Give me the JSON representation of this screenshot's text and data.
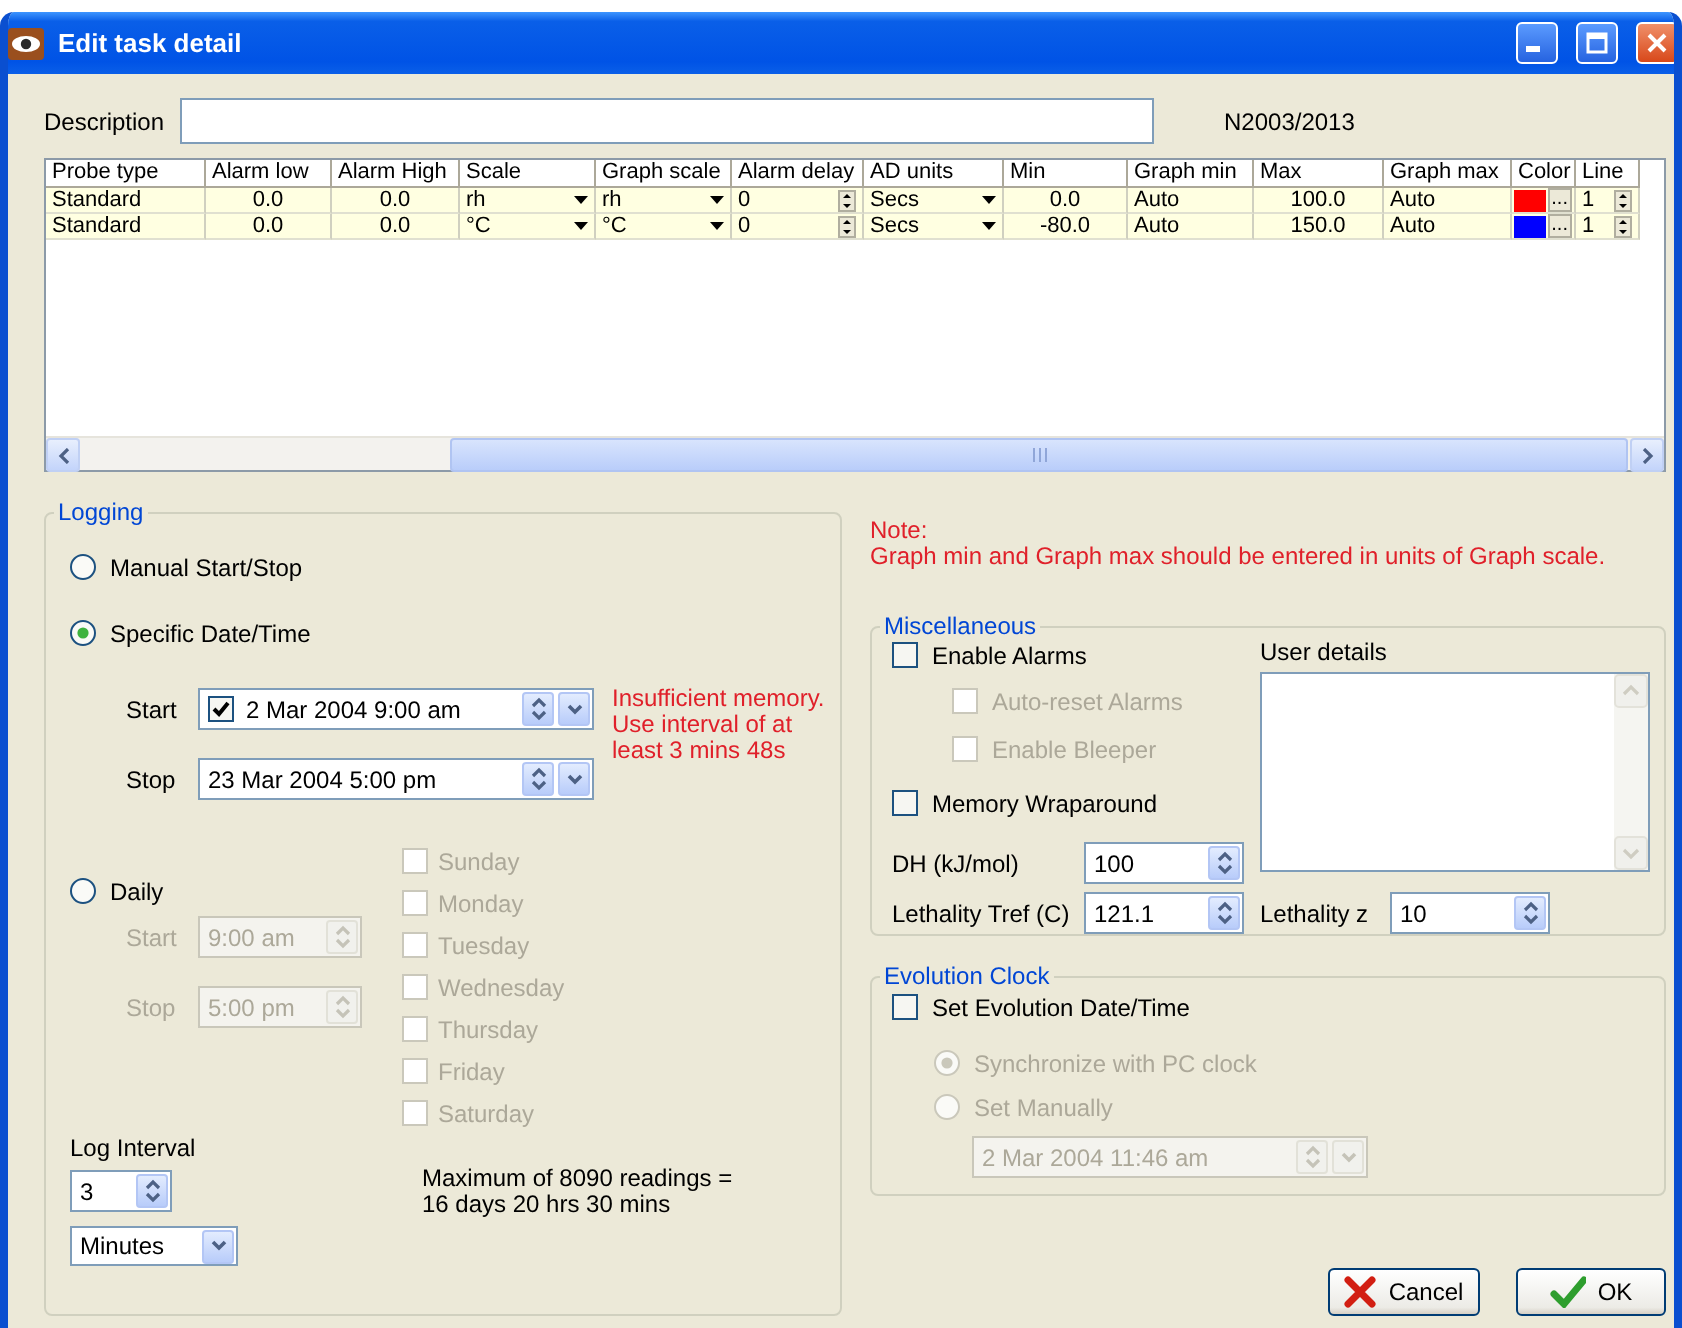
{
  "window": {
    "title": "Edit task detail"
  },
  "description": {
    "label": "Description"
  },
  "task_id": "N2003/2013",
  "probe_table": {
    "columns": [
      {
        "label": "Probe type",
        "kind": "text"
      },
      {
        "label": "Alarm low",
        "kind": "number"
      },
      {
        "label": "Alarm High",
        "kind": "number"
      },
      {
        "label": "Scale",
        "kind": "combo"
      },
      {
        "label": "Graph scale",
        "kind": "combo"
      },
      {
        "label": "Alarm delay",
        "kind": "spin"
      },
      {
        "label": "AD units",
        "kind": "combo"
      },
      {
        "label": "Min",
        "kind": "number"
      },
      {
        "label": "Graph min",
        "kind": "text"
      },
      {
        "label": "Max",
        "kind": "number"
      },
      {
        "label": "Graph max",
        "kind": "text"
      },
      {
        "label": "Color",
        "kind": "color"
      },
      {
        "label": "Line",
        "kind": "spin"
      }
    ],
    "rows": [
      {
        "cells": [
          "Standard",
          "0.0",
          "0.0",
          "rh",
          "rh",
          "0",
          "Secs",
          "0.0",
          "Auto",
          "100.0",
          "Auto",
          "1"
        ],
        "color": "#ff0000",
        "color_button": "..."
      },
      {
        "cells": [
          "Standard",
          "0.0",
          "0.0",
          "°C",
          "°C",
          "0",
          "Secs",
          "-80.0",
          "Auto",
          "150.0",
          "Auto",
          "1"
        ],
        "color": "#0000ff",
        "color_button": "..."
      }
    ]
  },
  "logging": {
    "title": "Logging",
    "modes": [
      {
        "label": "Manual Start/Stop",
        "selected": false
      },
      {
        "label": "Specific Date/Time",
        "selected": true
      },
      {
        "label": "Daily",
        "selected": false
      }
    ],
    "specific": {
      "start": {
        "label": "Start",
        "checked": true,
        "value": "2 Mar 2004 9:00 am"
      },
      "stop": {
        "label": "Stop",
        "value": "23 Mar 2004 5:00 pm"
      },
      "warning": "Insufficient memory.\nUse interval of at\nleast 3 mins 48s"
    },
    "daily": {
      "disabled": true,
      "start": {
        "label": "Start",
        "value": "9:00 am"
      },
      "stop": {
        "label": "Stop",
        "value": "5:00 pm"
      },
      "days": [
        {
          "label": "Sunday",
          "checked": false,
          "disabled": true
        },
        {
          "label": "Monday",
          "checked": false,
          "disabled": true
        },
        {
          "label": "Tuesday",
          "checked": false,
          "disabled": true
        },
        {
          "label": "Wednesday",
          "checked": false,
          "disabled": true
        },
        {
          "label": "Thursday",
          "checked": false,
          "disabled": true
        },
        {
          "label": "Friday",
          "checked": false,
          "disabled": true
        },
        {
          "label": "Saturday",
          "checked": false,
          "disabled": true
        }
      ]
    },
    "interval": {
      "label": "Log Interval",
      "value": "3",
      "unit": "Minutes"
    },
    "maximum": "Maximum of 8090 readings =\n16 days 20 hrs 30 mins"
  },
  "note": {
    "title": "Note:",
    "text": "Graph min and Graph max should be entered in units of Graph scale."
  },
  "misc": {
    "title": "Miscellaneous",
    "options": [
      {
        "label": "Enable Alarms",
        "checked": false,
        "disabled": false,
        "children": [
          {
            "label": "Auto-reset Alarms",
            "checked": false,
            "disabled": true
          },
          {
            "label": "Enable Bleeper",
            "checked": false,
            "disabled": true
          }
        ]
      },
      {
        "label": "Memory Wraparound",
        "checked": false,
        "disabled": false
      }
    ],
    "dh": {
      "label": "DH (kJ/mol)",
      "value": "100"
    },
    "tref": {
      "label": "Lethality Tref (C)",
      "value": "121.1"
    },
    "z": {
      "label": "Lethality z",
      "value": "10"
    },
    "user_details": {
      "label": "User details"
    }
  },
  "evolution": {
    "title": "Evolution Clock",
    "option": {
      "label": "Set Evolution Date/Time",
      "checked": false
    },
    "sources": [
      {
        "label": "Synchronize with PC clock",
        "selected": true,
        "disabled": true
      },
      {
        "label": "Set Manually",
        "selected": false,
        "disabled": true
      }
    ],
    "datetime": {
      "value": "2 Mar 2004 11:46 am",
      "disabled": true
    }
  },
  "buttons": [
    {
      "label": "Cancel",
      "kind": "cancel"
    },
    {
      "label": "OK",
      "kind": "ok"
    }
  ]
}
